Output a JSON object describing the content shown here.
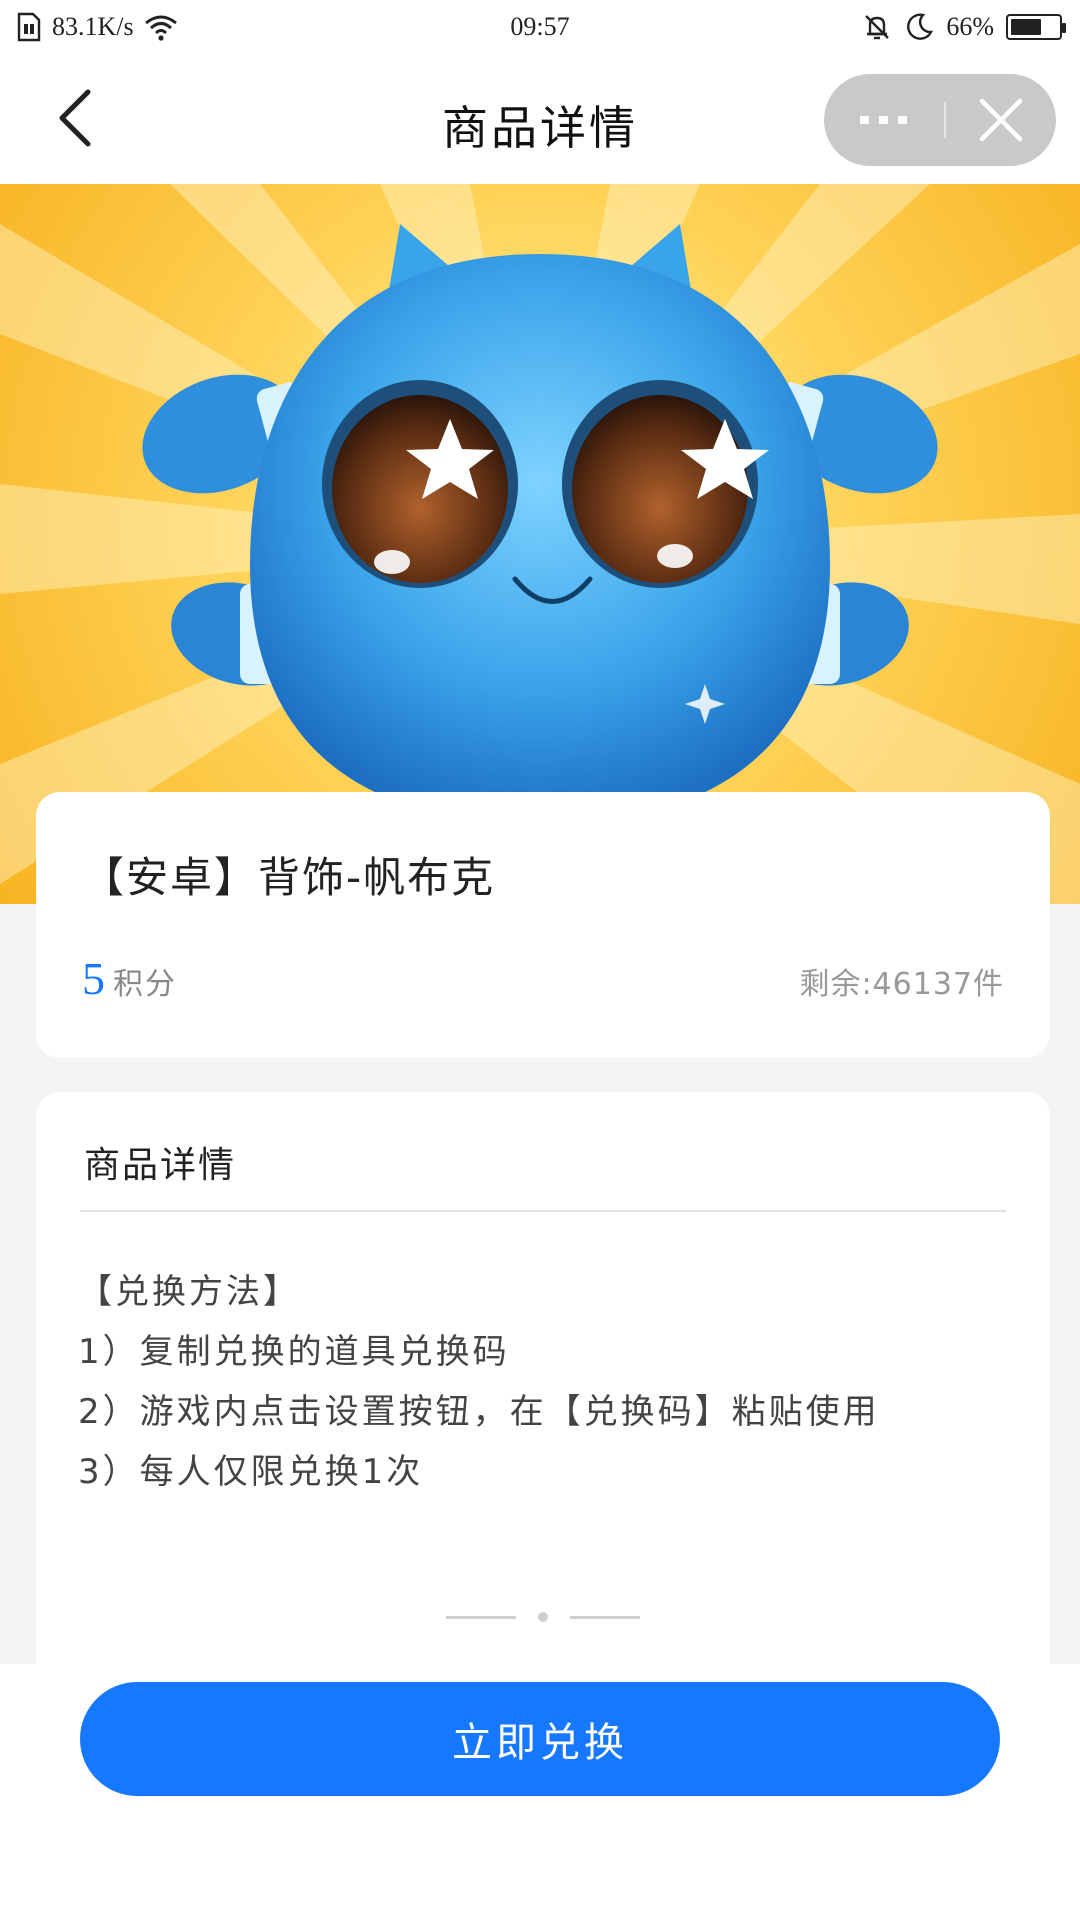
{
  "status_bar": {
    "net_speed": "83.1K/s",
    "time": "09:57",
    "battery": "66%",
    "battery_level": 0.66
  },
  "header": {
    "title": "商品详情"
  },
  "product": {
    "name": "【安卓】背饰-帆布克",
    "points_value": "5",
    "points_unit": "积分",
    "stock": "剩余:46137件"
  },
  "details": {
    "title": "商品详情",
    "lines": [
      "【兑换方法】",
      "1）复制兑换的道具兑换码",
      "2）游戏内点击设置按钮，在【兑换码】粘贴使用",
      "3）每人仅限兑换1次"
    ]
  },
  "action": {
    "redeem_label": "立即兑换"
  },
  "colors": {
    "accent": "#1677ff",
    "hero_yellow": "#ffd45a",
    "character_blue": "#3fa6ea"
  }
}
